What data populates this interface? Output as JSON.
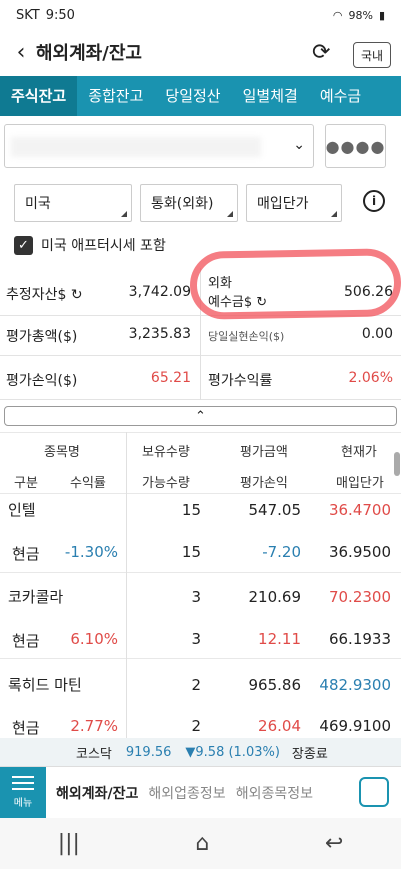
{
  "status_bar": {
    "carrier": "SKT",
    "time": "9:50",
    "battery": "98%"
  },
  "header": {
    "title": "해외계좌/잔고",
    "market_button": "국내"
  },
  "tabs": [
    "주식잔고",
    "종합잔고",
    "당일정산",
    "일별체결",
    "예수금"
  ],
  "account": {
    "password_mask": "●●●●"
  },
  "filters": {
    "country": "미국",
    "currency": "통화(외화)",
    "price": "매입단가"
  },
  "checkbox": {
    "label": "미국 애프터시세 포함"
  },
  "summary": {
    "est_assets_label": "추정자산$",
    "est_assets_value": "3,742.09",
    "deposit_label_1": "외화",
    "deposit_label_2": "예수금$",
    "deposit_value": "506.26",
    "eval_total_label": "평가총액($)",
    "eval_total_value": "3,235.83",
    "realized_label": "당일실현손익($)",
    "realized_value": "0.00",
    "eval_pl_label": "평가손익($)",
    "eval_pl_value": "65.21",
    "eval_rate_label": "평가수익률",
    "eval_rate_value": "2.06%"
  },
  "table_headers": {
    "row1": [
      "종목명",
      "보유수량",
      "평가금액",
      "현재가"
    ],
    "row2": [
      "구분",
      "수익률",
      "가능수량",
      "평가손익",
      "매입단가"
    ]
  },
  "holdings": [
    {
      "name": "인텔",
      "qty": "15",
      "eval": "547.05",
      "price": "36.4700",
      "type": "현금",
      "rate": "-1.30%",
      "avail": "15",
      "pl": "-7.20",
      "cost": "36.9500"
    },
    {
      "name": "코카콜라",
      "qty": "3",
      "eval": "210.69",
      "price": "70.2300",
      "type": "현금",
      "rate": "6.10%",
      "avail": "3",
      "pl": "12.11",
      "cost": "66.1933"
    },
    {
      "name": "록히드 마틴",
      "qty": "2",
      "eval": "965.86",
      "price": "482.9300",
      "type": "현금",
      "rate": "2.77%",
      "avail": "2",
      "pl": "26.04",
      "cost": "469.9100"
    }
  ],
  "ticker": {
    "index": "코스닥",
    "value": "919.56",
    "change": "▼9.58 (1.03%)",
    "status": "장종료"
  },
  "bottom_nav": {
    "menu": "메뉴",
    "items": [
      "해외계좌/잔고",
      "해외업종정보",
      "해외종목정보"
    ]
  },
  "colors": {
    "accent": "#1a93b0",
    "up": "#e04b48",
    "down": "#2a7fb0"
  }
}
